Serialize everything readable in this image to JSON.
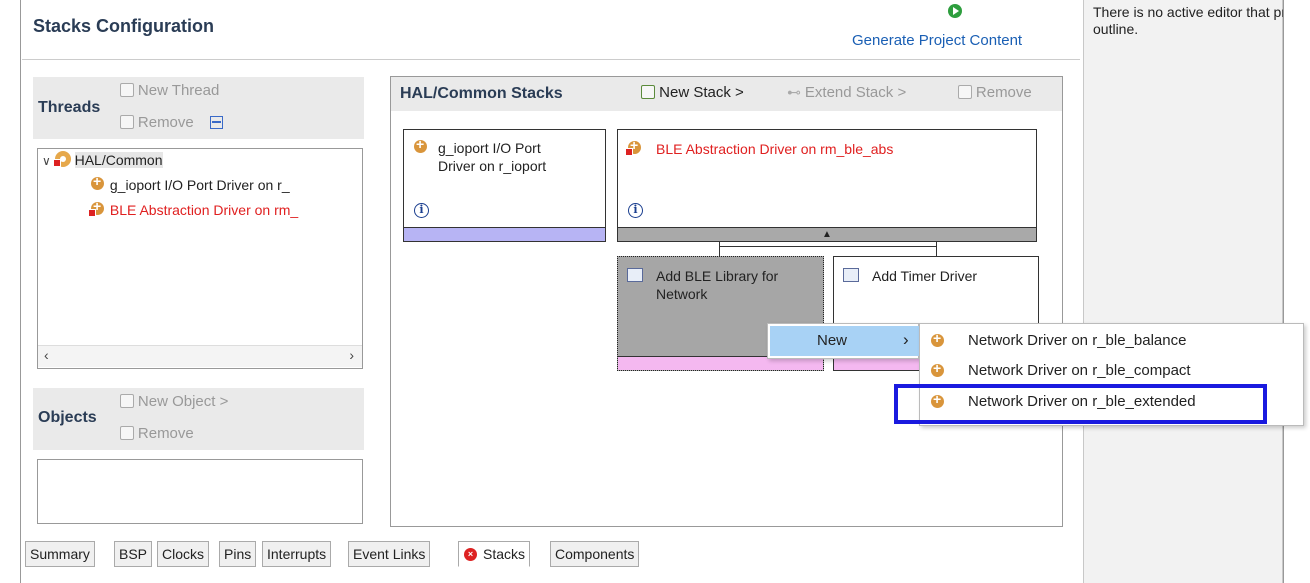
{
  "editor": {
    "title": "Stacks Configuration",
    "generate_label": "Generate Project Content"
  },
  "outline": {
    "message": "There is no active editor that provides an\noutline."
  },
  "threads": {
    "title": "Threads",
    "new_thread_label": "New Thread",
    "remove_label": "Remove",
    "tree": [
      {
        "label": "HAL/Common"
      },
      {
        "label": "g_ioport I/O Port Driver on r_"
      },
      {
        "label": "BLE Abstraction Driver on rm_"
      }
    ]
  },
  "objects": {
    "title": "Objects",
    "new_object_label": "New Object >",
    "remove_label": "Remove"
  },
  "stacks": {
    "title": "HAL/Common Stacks",
    "new_stack_label": "New Stack >",
    "extend_stack_label": "Extend Stack >",
    "remove_label": "Remove",
    "cards": {
      "ioport": {
        "line1": "g_ioport I/O Port",
        "line2": "Driver on r_ioport"
      },
      "ble": {
        "label": "BLE Abstraction Driver on rm_ble_abs"
      },
      "add_ble_lib": {
        "line1": "Add BLE Library for",
        "line2": "Network"
      },
      "add_timer": {
        "label": "Add Timer Driver"
      }
    }
  },
  "context_menu": {
    "new_label": "New",
    "arrow": "›",
    "submenu": [
      "Network Driver on r_ble_balance",
      "Network Driver on r_ble_compact",
      "Network Driver on r_ble_extended"
    ]
  },
  "tabs": [
    "Summary",
    "BSP",
    "Clocks",
    "Pins",
    "Interrupts",
    "Event Links",
    "Stacks",
    "Components"
  ],
  "colors": {
    "accent_link": "#1a5fb4",
    "error_red": "#e02020",
    "highlight_box": "#1a1adf",
    "menu_hover": "#a8d2f5",
    "lavender": "#b7b4f4",
    "pink": "#f4b8f0"
  }
}
